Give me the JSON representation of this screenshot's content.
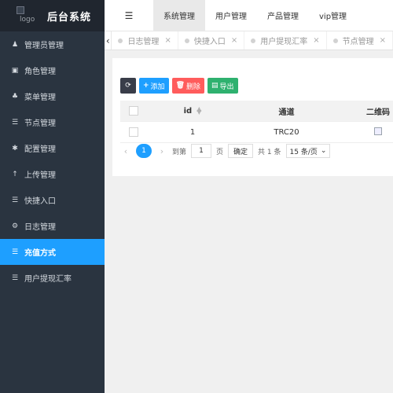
{
  "logo": {
    "alt": "logo",
    "title": "后台系统"
  },
  "sidebar": {
    "items": [
      {
        "label": "管理员管理",
        "icon": "person-icon",
        "glyph": "♟"
      },
      {
        "label": "角色管理",
        "icon": "role-icon",
        "glyph": "▣"
      },
      {
        "label": "菜单管理",
        "icon": "tree-icon",
        "glyph": "♣"
      },
      {
        "label": "节点管理",
        "icon": "list-icon",
        "glyph": "☰"
      },
      {
        "label": "配置管理",
        "icon": "asterisk-icon",
        "glyph": "✱"
      },
      {
        "label": "上传管理",
        "icon": "arrow-up-icon",
        "glyph": "↑"
      },
      {
        "label": "快捷入口",
        "icon": "list-icon",
        "glyph": "☰"
      },
      {
        "label": "日志管理",
        "icon": "gear-icon",
        "glyph": "⚙"
      },
      {
        "label": "充值方式",
        "icon": "list-icon",
        "glyph": "☰",
        "active": true
      },
      {
        "label": "用户提现汇率",
        "icon": "list-icon",
        "glyph": "☰"
      }
    ]
  },
  "header": {
    "fold_icon": "☰",
    "tabs": [
      {
        "label": "系统管理",
        "active": true
      },
      {
        "label": "用户管理"
      },
      {
        "label": "产品管理"
      },
      {
        "label": "vip管理"
      }
    ]
  },
  "nav_tabs": {
    "prev": "‹",
    "items": [
      {
        "label": "日志管理"
      },
      {
        "label": "快捷入口"
      },
      {
        "label": "用户提现汇率"
      },
      {
        "label": "节点管理"
      }
    ],
    "close": "×"
  },
  "toolbar": {
    "refresh": "⟳",
    "add": "添加",
    "delete": "删除",
    "export": "导出"
  },
  "table": {
    "headers": {
      "id": "id",
      "channel": "通道",
      "qr": "二维码"
    },
    "rows": [
      {
        "id": "1",
        "channel": "TRC20"
      }
    ]
  },
  "pager": {
    "current": "1",
    "goto": "到第",
    "page_input": "1",
    "page_unit": "页",
    "confirm": "确定",
    "total": "共 1 条",
    "per_page": "15 条/页"
  },
  "colors": {
    "primary": "#1e9fff",
    "sidebar": "#2a3440",
    "danger": "#ff5c5c",
    "success": "#2fb16f",
    "dark": "#393d49"
  }
}
